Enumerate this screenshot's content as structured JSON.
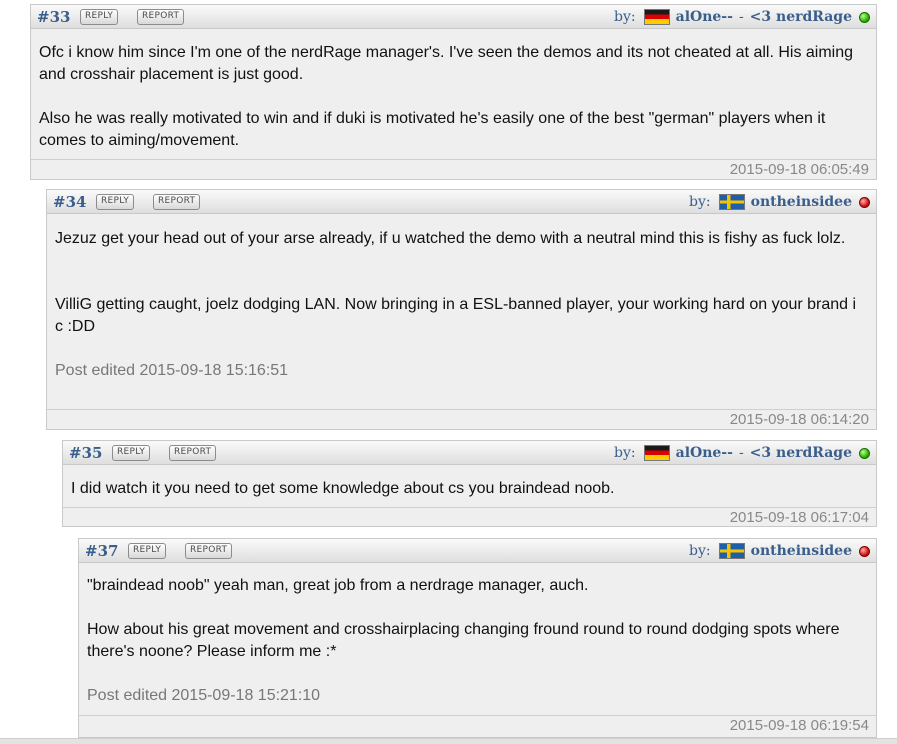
{
  "posts": [
    {
      "number": "#33",
      "reply_label": "REPLY",
      "report_label": "REPORT",
      "by_label": "by:",
      "flag": "germany-flag",
      "username": "alOne--",
      "separator": "-",
      "team": "<3 nerdRage",
      "status": "online",
      "paragraphs": [
        "Ofc i know him since I'm one of the nerdRage manager's. I've seen the demos and its not cheated at all. His aiming and crosshair placement is just good.",
        "Also he was really motivated to win and if duki is motivated he's easily one of the best \"german\" players when it comes to aiming/movement."
      ],
      "edited": "",
      "timestamp": "2015-09-18 06:05:49"
    },
    {
      "number": "#34",
      "reply_label": "REPLY",
      "report_label": "REPORT",
      "by_label": "by:",
      "flag": "sweden-flag",
      "username": "ontheinsidee",
      "status": "offline",
      "paragraphs": [
        "Jezuz get your head out of your arse already, if u watched the demo with a neutral mind this is fishy as fuck lolz.",
        "VilliG getting caught, joelz dodging LAN. Now bringing in a ESL-banned player, your working hard on your brand i c :DD"
      ],
      "edited": "Post edited 2015-09-18 15:16:51",
      "timestamp": "2015-09-18 06:14:20"
    },
    {
      "number": "#35",
      "reply_label": "REPLY",
      "report_label": "REPORT",
      "by_label": "by:",
      "flag": "germany-flag",
      "username": "alOne--",
      "separator": "-",
      "team": "<3 nerdRage",
      "status": "online",
      "paragraphs": [
        "I did watch it you need to get some knowledge about cs you braindead noob."
      ],
      "edited": "",
      "timestamp": "2015-09-18 06:17:04"
    },
    {
      "number": "#37",
      "reply_label": "REPLY",
      "report_label": "REPORT",
      "by_label": "by:",
      "flag": "sweden-flag",
      "username": "ontheinsidee",
      "status": "offline",
      "paragraphs": [
        "\"braindead noob\" yeah man, great job from a nerdrage manager, auch.",
        "How about his great movement and crosshairplacing changing fround round to round dodging spots where there's noone? Please inform me :*"
      ],
      "edited": "Post edited 2015-09-18 15:21:10",
      "timestamp": "2015-09-18 06:19:54"
    }
  ],
  "colors": {
    "link": "#3a5e8c",
    "status_online": "#2fb300",
    "status_offline": "#d41515",
    "post_bg": "#efefef",
    "timestamp": "#888888"
  }
}
